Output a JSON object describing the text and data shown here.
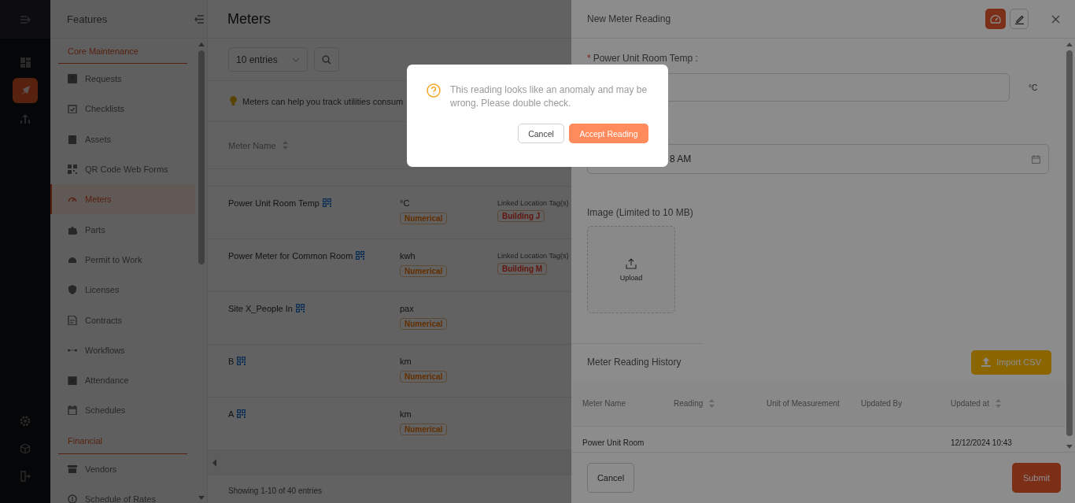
{
  "nav_rail": {
    "items": [
      {
        "selected": false
      },
      {
        "selected": true
      },
      {
        "selected": false
      }
    ]
  },
  "features_panel": {
    "title": "Features",
    "sections": [
      {
        "title": "Core Maintenance",
        "items": [
          {
            "label": "Requests",
            "selected": false
          },
          {
            "label": "Checklists",
            "selected": false
          },
          {
            "label": "Assets",
            "selected": false
          },
          {
            "label": "QR Code Web Forms",
            "selected": false
          },
          {
            "label": "Meters",
            "selected": true
          },
          {
            "label": "Parts",
            "selected": false
          },
          {
            "label": "Permit to Work",
            "selected": false
          },
          {
            "label": "Licenses",
            "selected": false
          },
          {
            "label": "Contracts",
            "selected": false
          },
          {
            "label": "Workflows",
            "selected": false
          },
          {
            "label": "Attendance",
            "selected": false
          },
          {
            "label": "Schedules",
            "selected": false
          }
        ]
      },
      {
        "title": "Financial",
        "items": [
          {
            "label": "Vendors",
            "selected": false
          },
          {
            "label": "Schedule of Rates",
            "selected": false
          }
        ]
      }
    ]
  },
  "main": {
    "title": "Meters",
    "entries_select": "10 entries",
    "tip": "Meters can help you track utilities consum",
    "table": {
      "columns": [
        {
          "label": "Meter Name",
          "sortable": true
        }
      ],
      "rows": [
        {
          "name": "Power Unit Room Temp",
          "unit": "°C",
          "type": "Numerical",
          "location_label": "Linked Location Tag(s)",
          "location_tag": "Building J"
        },
        {
          "name": "Power Meter for Common Room",
          "unit": "kwh",
          "type": "Numerical",
          "location_label": "Linked Location Tag(s)",
          "location_tag": "Building M"
        },
        {
          "name": "Site X_People In",
          "unit": "pax",
          "type": "Numerical"
        },
        {
          "name": "B",
          "unit": "km",
          "type": "Numerical"
        },
        {
          "name": "A",
          "unit": "km",
          "type": "Numerical"
        }
      ]
    },
    "footer": "Showing 1-10 of 40 entries"
  },
  "drawer": {
    "title": "New Meter Reading",
    "required_mark": "*",
    "field_label": "Power Unit Room Temp :",
    "unit": "°C",
    "date_value": "8 AM",
    "image_label": "Image (Limited to 10 MB)",
    "upload_label": "Upload",
    "history_title": "Meter Reading History",
    "import_button": "Import CSV",
    "history_table": {
      "columns": [
        {
          "label": "Meter Name",
          "sortable": false
        },
        {
          "label": "Reading",
          "sortable": true
        },
        {
          "label": "Unit of Measurement",
          "sortable": false
        },
        {
          "label": "Updated By",
          "sortable": false
        },
        {
          "label": "Updated at",
          "sortable": true
        }
      ],
      "rows": [
        {
          "meter_name": "Power Unit Room",
          "updated_at": "12/12/2024 10:43"
        }
      ]
    },
    "cancel_button": "Cancel",
    "submit_button": "Submit"
  },
  "dialog": {
    "message": "This reading looks like an anomaly and may be wrong. Please double check.",
    "cancel_button": "Cancel",
    "accept_button": "Accept Reading"
  }
}
